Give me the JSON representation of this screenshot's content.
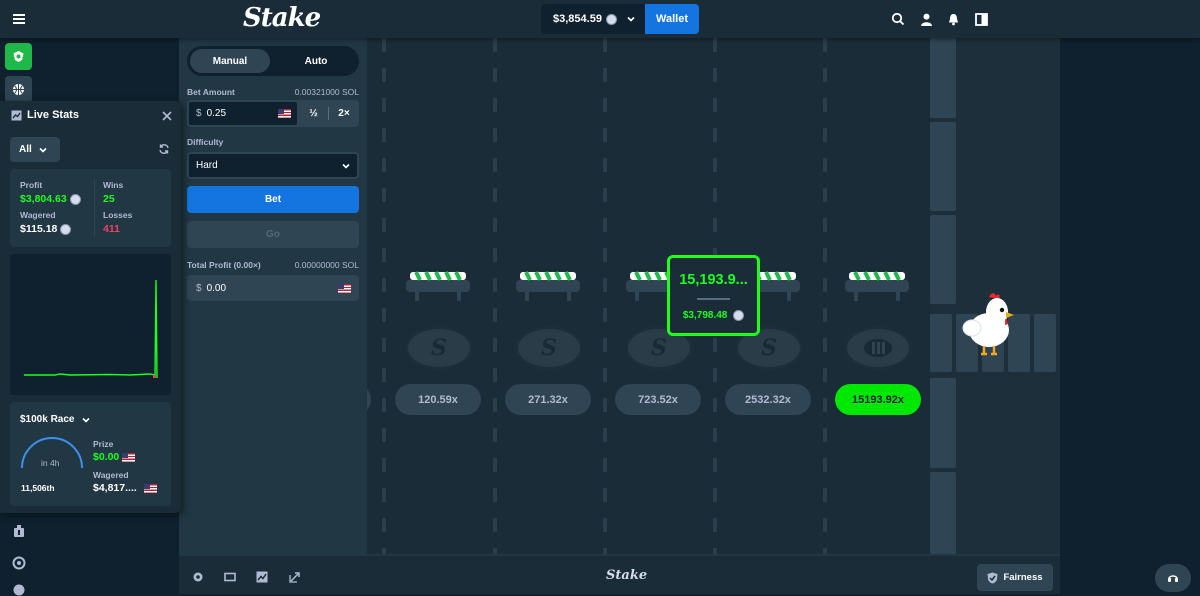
{
  "header": {
    "logo": "Stake",
    "balance": "$3,854.59",
    "wallet_label": "Wallet"
  },
  "controls": {
    "tabs": [
      "Manual",
      "Auto"
    ],
    "bet_amount_label": "Bet Amount",
    "bet_amount_crypto": "0.00321000 SOL",
    "bet_currency": "$",
    "bet_value": "0.25",
    "half_label": "½",
    "double_label": "2×",
    "difficulty_label": "Difficulty",
    "difficulty_value": "Hard",
    "bet_button": "Bet",
    "go_button": "Go",
    "total_profit_label": "Total Profit (0.00×)",
    "total_profit_crypto": "0.00000000 SOL",
    "profit_currency": "$",
    "profit_value": "0.00"
  },
  "game": {
    "multipliers": [
      "120.59x",
      "271.32x",
      "723.52x",
      "2532.32x",
      "15193.92x"
    ],
    "win_popup_multiplier": "15,193.9...",
    "win_popup_amount": "$3,798.48",
    "lane_symbol": "S",
    "accent_green": "#00e701",
    "popup_border": "#1fff20"
  },
  "footer": {
    "logo": "Stake",
    "fairness_label": "Fairness"
  },
  "live_stats": {
    "title": "Live Stats",
    "filter": "All",
    "profit_label": "Profit",
    "profit_value": "$3,804.63",
    "wins_label": "Wins",
    "wins_value": "25",
    "wagered_label": "Wagered",
    "wagered_value": "$115.18",
    "losses_label": "Losses",
    "losses_value": "411",
    "race_title": "$100k Race",
    "race_time": "in 4h",
    "race_rank": "11,506th",
    "race_prize_label": "Prize",
    "race_prize_value": "$0.00",
    "race_wagered_label": "Wagered",
    "race_wagered_value": "$4,817...."
  }
}
